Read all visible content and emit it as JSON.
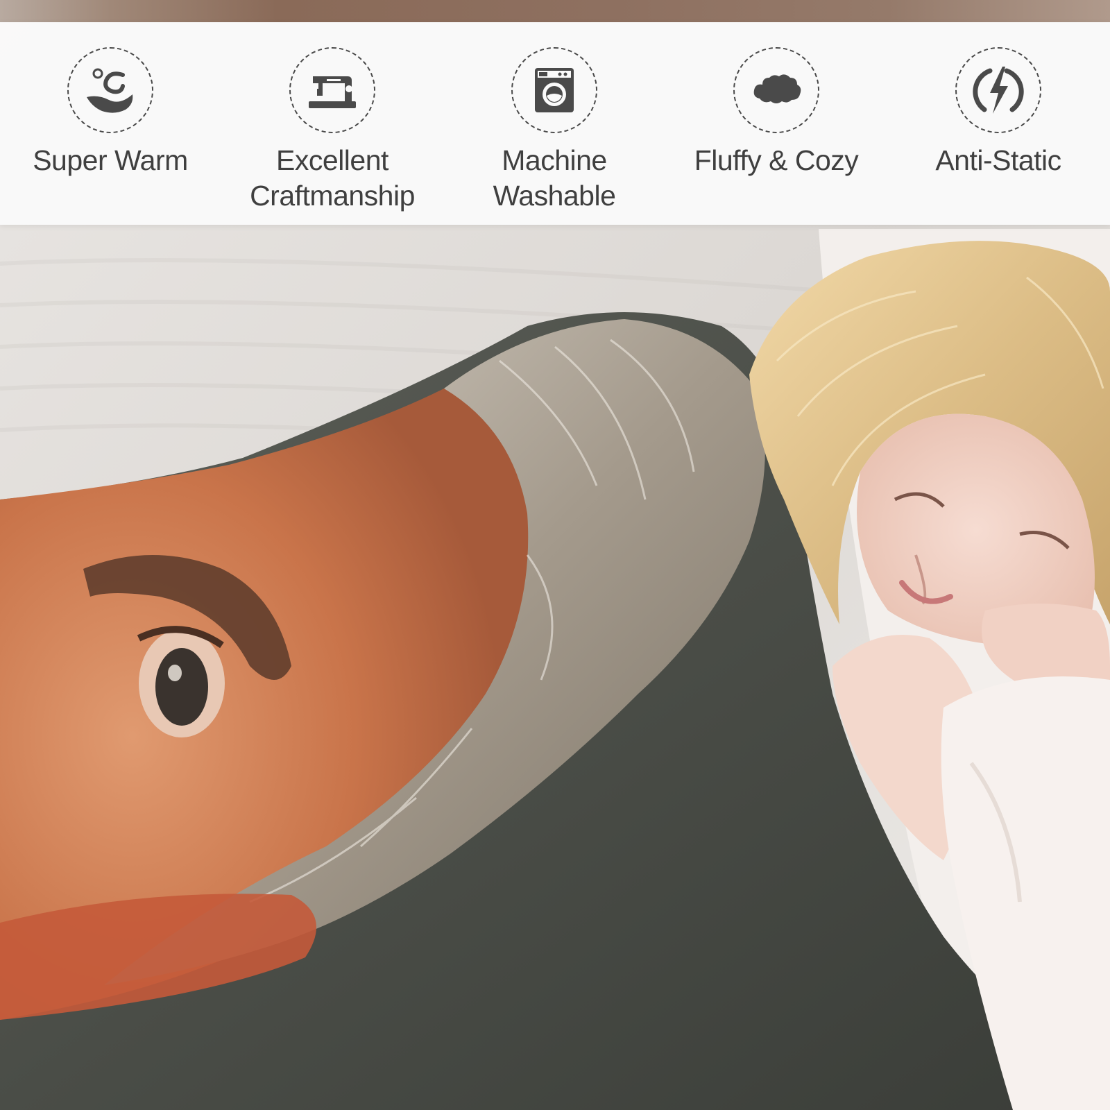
{
  "features": [
    {
      "label": "Super Warm",
      "icon": "warm-hand-icon"
    },
    {
      "label": "Excellent\nCraftmanship",
      "icon": "sewing-machine-icon"
    },
    {
      "label": "Machine\nWashable",
      "icon": "washing-machine-icon"
    },
    {
      "label": "Fluffy & Cozy",
      "icon": "cloud-icon"
    },
    {
      "label": "Anti-Static",
      "icon": "lightning-bolt-icon"
    }
  ],
  "colors": {
    "icon": "#4a4a4a",
    "label": "#3f3f3f",
    "band": "#fafafa"
  }
}
